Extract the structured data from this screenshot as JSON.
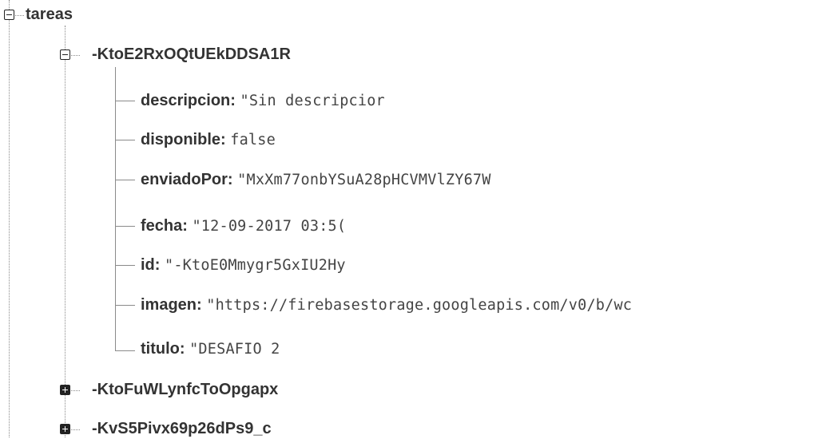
{
  "root": {
    "key": "tareas",
    "expanded": true
  },
  "task_open": {
    "key": "-KtoE2RxOQtUEkDDSA1R",
    "expanded": true,
    "fields": [
      {
        "key": "descripcion:",
        "value": "\"Sin descripcior"
      },
      {
        "key": "disponible:",
        "value": "false"
      },
      {
        "key": "enviadoPor:",
        "value": "\"MxXm77onbYSuA28pHCVMVlZY67W"
      },
      {
        "key": "fecha:",
        "value": "\"12-09-2017 03:5("
      },
      {
        "key": "id:",
        "value": "\"-KtoE0Mmygr5GxIU2Hy"
      },
      {
        "key": "imagen:",
        "value": "\"https://firebasestorage.googleapis.com/v0/b/wc"
      },
      {
        "key": "titulo:",
        "value": "\"DESAFIO 2"
      }
    ]
  },
  "task_collapsed": [
    {
      "key": "-KtoFuWLynfcToOpgapx",
      "expanded": false
    },
    {
      "key": "-KvS5Pivx69p26dPs9_c",
      "expanded": false
    }
  ]
}
